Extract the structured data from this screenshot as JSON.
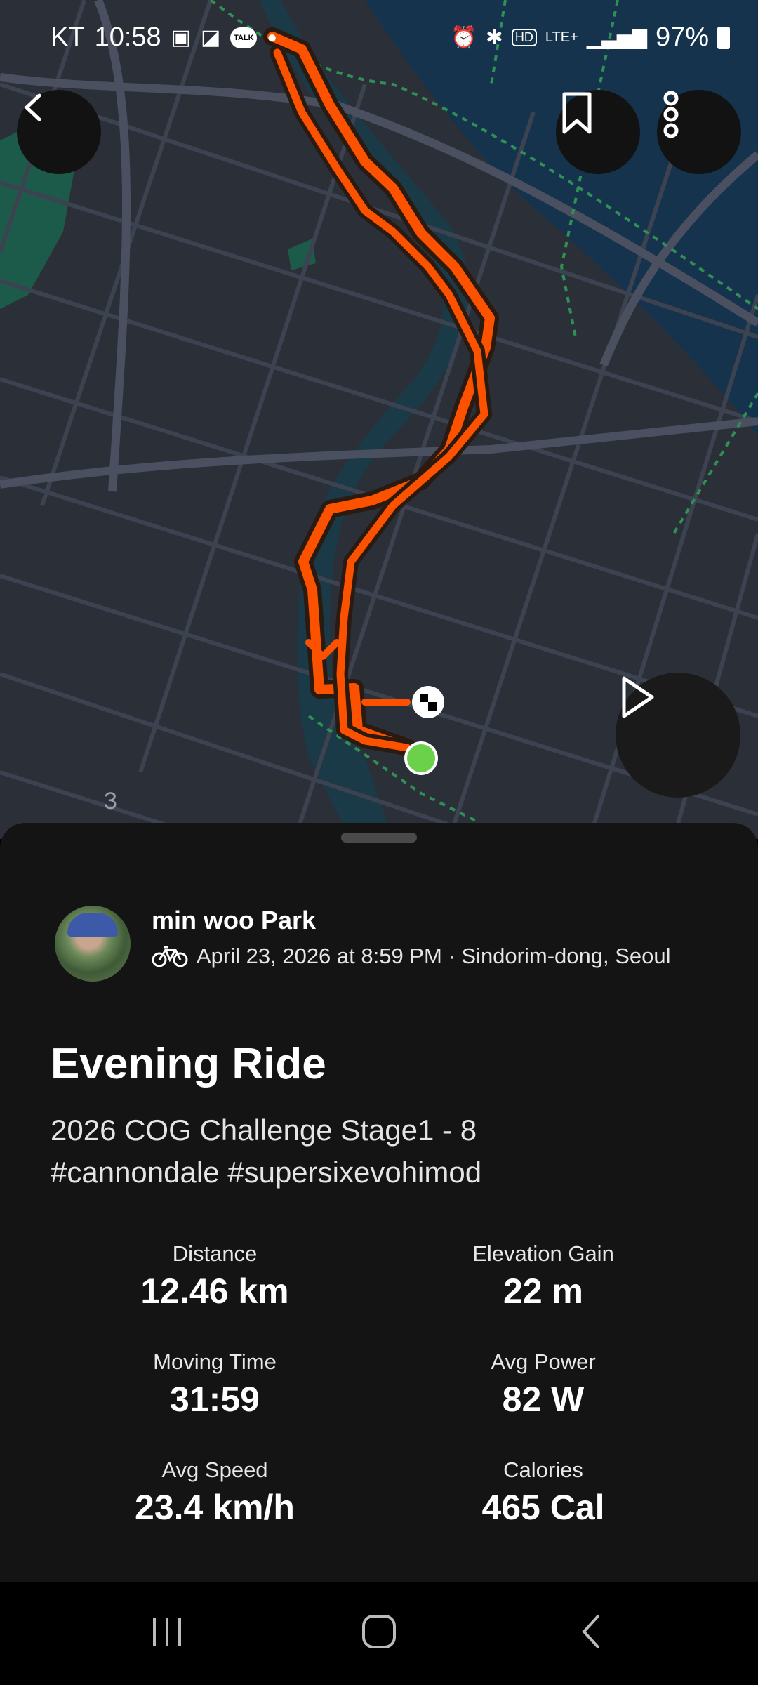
{
  "status_bar": {
    "carrier": "KT",
    "time": "10:58",
    "network": "LTE+",
    "battery": "97%",
    "left_icons": [
      "image-icon",
      "app-icon",
      "talk-icon",
      "dot-icon"
    ],
    "right_icons": [
      "alarm-icon",
      "bluetooth-icon",
      "hd-icon",
      "lte-icon",
      "signal-icon",
      "battery-icon"
    ]
  },
  "map": {
    "route_color": "#fc5200",
    "water_color": "#16334d",
    "park_color": "#1c5b49",
    "road_label": "3"
  },
  "header_buttons": {
    "back": "back-chevron-icon",
    "bookmark": "bookmark-icon",
    "more": "more-vertical-icon",
    "play": "play-icon"
  },
  "activity": {
    "athlete": "min woo Park",
    "sport_icon": "bike-icon",
    "date_location": "April 23, 2026 at 8:59 PM · Sindorim-dong, Seoul",
    "title": "Evening Ride",
    "description": "2026  COG Challenge Stage1 - 8\n#cannondale  #supersixevohimod"
  },
  "stats": [
    {
      "label": "Distance",
      "value": "12.46 km"
    },
    {
      "label": "Elevation Gain",
      "value": "22 m"
    },
    {
      "label": "Moving Time",
      "value": "31:59"
    },
    {
      "label": "Avg Power",
      "value": "82 W"
    },
    {
      "label": "Avg Speed",
      "value": "23.4 km/h"
    },
    {
      "label": "Calories",
      "value": "465 Cal"
    }
  ],
  "nav_bar": [
    "recents-icon",
    "home-icon",
    "back-icon"
  ]
}
